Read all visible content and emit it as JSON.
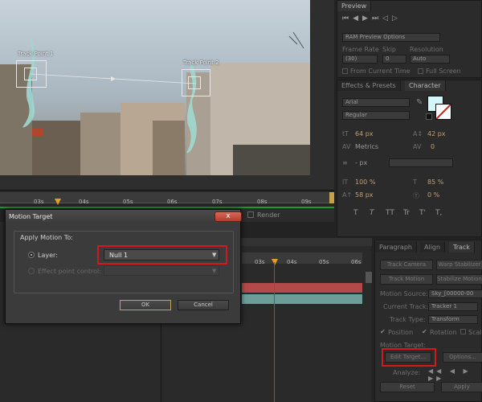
{
  "viewer": {
    "track_point_1": "Track Point 1",
    "track_point_2": "Track Point 2"
  },
  "preview": {
    "tab_label": "Preview",
    "ram_preview": "RAM Preview Options",
    "frame_rate_label": "Frame Rate",
    "skip_label": "Skip",
    "resolution_label": "Resolution",
    "frame_rate_value": "(30)",
    "skip_value": "0",
    "resolution_value": "Auto",
    "from_current_time": "From Current Time",
    "full_screen": "Full Screen"
  },
  "character": {
    "tab_effects": "Effects & Presets",
    "tab_character": "Character",
    "font": "Arial",
    "style": "Regular",
    "size": "64 px",
    "leading": "42 px",
    "kerning": "Metrics",
    "tracking": "0",
    "stroke": "- px",
    "v_scale": "100 %",
    "h_scale": "85 %",
    "baseline": "58 px",
    "tsume": "0 %",
    "styles": [
      "T",
      "T",
      "TT",
      "Tr",
      "T'",
      "T,"
    ]
  },
  "timeline_top": {
    "ticks": [
      "03s",
      "04s",
      "05s",
      "06s",
      "07s",
      "08s",
      "09s"
    ],
    "render_label": "Render"
  },
  "timeline_bottom": {
    "ticks": [
      "03s",
      "04s",
      "05s",
      "06s"
    ]
  },
  "dialog": {
    "title": "Motion Target",
    "close": "x",
    "group_label": "Apply Motion To:",
    "layer_label": "Layer:",
    "layer_value": "Null 1",
    "effect_point_label": "Effect point control:",
    "ok": "OK",
    "cancel": "Cancel"
  },
  "tracker": {
    "tab_paragraph": "Paragraph",
    "tab_align": "Align",
    "tab_tracker": "Track",
    "track_camera": "Track Camera",
    "warp_stabilizer": "Warp Stabilizer",
    "track_motion": "Track Motion",
    "stabilize_motion": "Stabilize Motion",
    "motion_source_label": "Motion Source:",
    "motion_source_value": "Sky_[00000-00",
    "current_track_label": "Current Track:",
    "current_track_value": "Tracker 1",
    "track_type_label": "Track Type:",
    "track_type_value": "Transform",
    "position": "Position",
    "rotation": "Rotation",
    "scale": "Scale",
    "motion_target_label": "Motion Target:",
    "edit_target": "Edit Target...",
    "options": "Options...",
    "analyze_label": "Analyze:",
    "reset": "Reset",
    "apply": "Apply"
  },
  "colors": {
    "accent_red": "#d31a1a",
    "timeline_green": "#1d9b2e",
    "layer_red": "#b24a4a",
    "layer_teal": "#6c9e97",
    "playhead": "#e0a020"
  }
}
